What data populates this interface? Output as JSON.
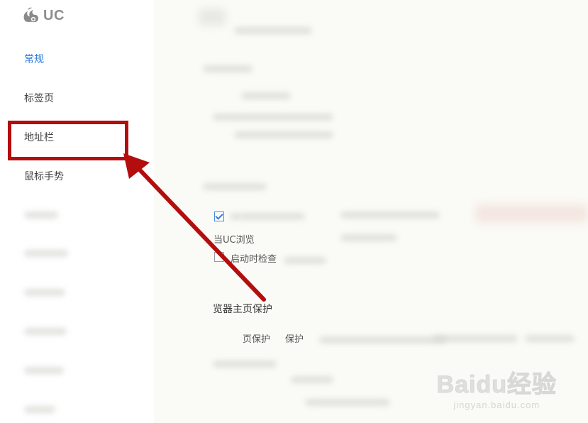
{
  "app": {
    "logo_text": "UC",
    "logo_icon": "squirrel-logo-icon"
  },
  "sidebar": {
    "items": [
      {
        "label": "常规",
        "active": true
      },
      {
        "label": "标签页",
        "active": false
      },
      {
        "label": "地址栏",
        "active": false,
        "highlighted": true
      },
      {
        "label": "鼠标手势",
        "active": false
      }
    ]
  },
  "main": {
    "partial_texts": {
      "when_uc": "当UC浏览",
      "startup_check": "启动时检查",
      "homepage_protection_heading": "览器主页保护",
      "homepage_protection_label": "页保护",
      "protect_prefix": "保护"
    },
    "checkboxes": {
      "default_browser_checked": true,
      "startup_check_checked": false
    }
  },
  "annotation": {
    "highlight_color": "#b30d0d",
    "arrow_color": "#b30d0d"
  },
  "watermark": {
    "main": "Baidu经验",
    "sub": "jingyan.baidu.com"
  },
  "colors": {
    "accent": "#2c7ad6",
    "annotation_red": "#b30d0d"
  }
}
